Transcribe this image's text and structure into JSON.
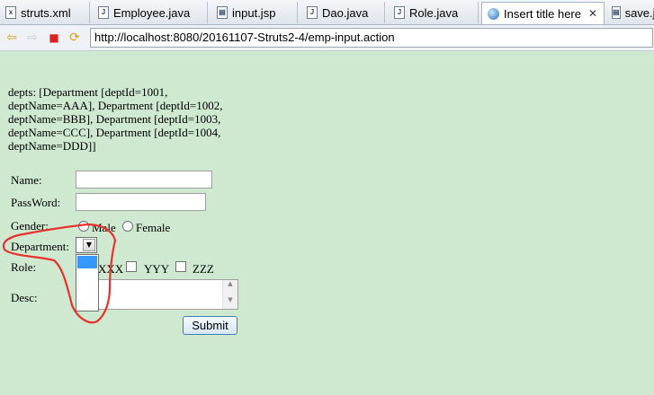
{
  "tabs": [
    {
      "label": "struts.xml",
      "icon": "xml-file-icon"
    },
    {
      "label": "Employee.java",
      "icon": "java-file-icon"
    },
    {
      "label": "input.jsp",
      "icon": "jsp-file-icon"
    },
    {
      "label": "Dao.java",
      "icon": "java-file-icon"
    },
    {
      "label": "Role.java",
      "icon": "java-file-icon"
    },
    {
      "label": "Insert title here",
      "icon": "globe-icon",
      "active": true,
      "close": "✕"
    },
    {
      "label": "save.j",
      "icon": "jsp-file-icon"
    }
  ],
  "toolbar": {
    "back": "⇦",
    "forward": "⇨",
    "stop": "■",
    "refresh": "⟳",
    "url": "http://localhost:8080/20161107-Struts2-4/emp-input.action"
  },
  "page": {
    "depts_text": "depts: [Department [deptId=1001, deptName=AAA], Department [deptId=1002, deptName=BBB], Department [deptId=1003, deptName=CCC], Department [deptId=1004, deptName=DDD]]",
    "name_label": "Name:",
    "password_label": "PassWord:",
    "gender_label": "Gender:",
    "gender_male": "Male",
    "gender_female": "Female",
    "department_label": "Department:",
    "role_label": "Role:",
    "role_xxx": "XXX",
    "role_yyy": "YYY",
    "role_zzz": "ZZZ",
    "desc_label": "Desc:",
    "submit_label": "Submit"
  },
  "colors": {
    "page_bg": "#cfe8d0",
    "annotation": "#e8322d",
    "selection": "#3399ff"
  }
}
